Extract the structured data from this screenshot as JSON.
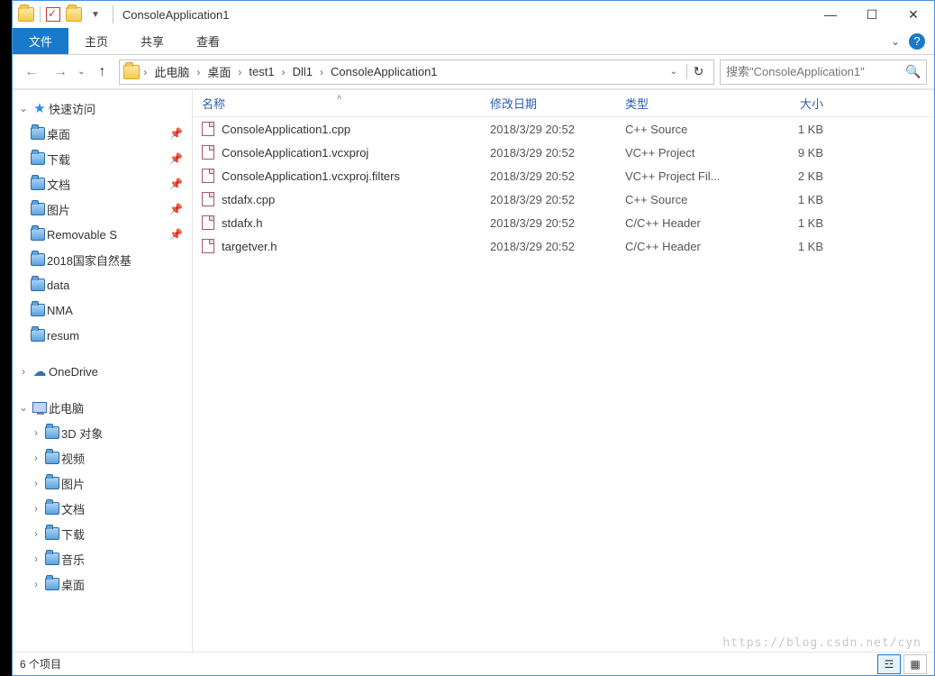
{
  "window": {
    "title": "ConsoleApplication1"
  },
  "ribbon": {
    "file": "文件",
    "tabs": [
      "主页",
      "共享",
      "查看"
    ]
  },
  "breadcrumbs": [
    "此电脑",
    "桌面",
    "test1",
    "Dll1",
    "ConsoleApplication1"
  ],
  "search": {
    "placeholder": "搜索\"ConsoleApplication1\""
  },
  "nav": {
    "quick_access": "快速访问",
    "quick_items": [
      {
        "label": "桌面",
        "pinned": true
      },
      {
        "label": "下载",
        "pinned": true
      },
      {
        "label": "文档",
        "pinned": true
      },
      {
        "label": "图片",
        "pinned": true
      },
      {
        "label": "Removable S",
        "pinned": true
      },
      {
        "label": "2018国家自然基",
        "pinned": false
      },
      {
        "label": "data",
        "pinned": false
      },
      {
        "label": "NMA",
        "pinned": false
      },
      {
        "label": "resum",
        "pinned": false
      }
    ],
    "onedrive": "OneDrive",
    "this_pc": "此电脑",
    "pc_items": [
      "3D 对象",
      "视频",
      "图片",
      "文档",
      "下载",
      "音乐",
      "桌面"
    ]
  },
  "columns": {
    "name": "名称",
    "modified": "修改日期",
    "type": "类型",
    "size": "大小"
  },
  "files": [
    {
      "name": "ConsoleApplication1.cpp",
      "modified": "2018/3/29 20:52",
      "type": "C++ Source",
      "size": "1 KB"
    },
    {
      "name": "ConsoleApplication1.vcxproj",
      "modified": "2018/3/29 20:52",
      "type": "VC++ Project",
      "size": "9 KB"
    },
    {
      "name": "ConsoleApplication1.vcxproj.filters",
      "modified": "2018/3/29 20:52",
      "type": "VC++ Project Fil...",
      "size": "2 KB"
    },
    {
      "name": "stdafx.cpp",
      "modified": "2018/3/29 20:52",
      "type": "C++ Source",
      "size": "1 KB"
    },
    {
      "name": "stdafx.h",
      "modified": "2018/3/29 20:52",
      "type": "C/C++ Header",
      "size": "1 KB"
    },
    {
      "name": "targetver.h",
      "modified": "2018/3/29 20:52",
      "type": "C/C++ Header",
      "size": "1 KB"
    }
  ],
  "status": {
    "text": "6 个项目"
  },
  "watermark": "https://blog.csdn.net/cyn"
}
